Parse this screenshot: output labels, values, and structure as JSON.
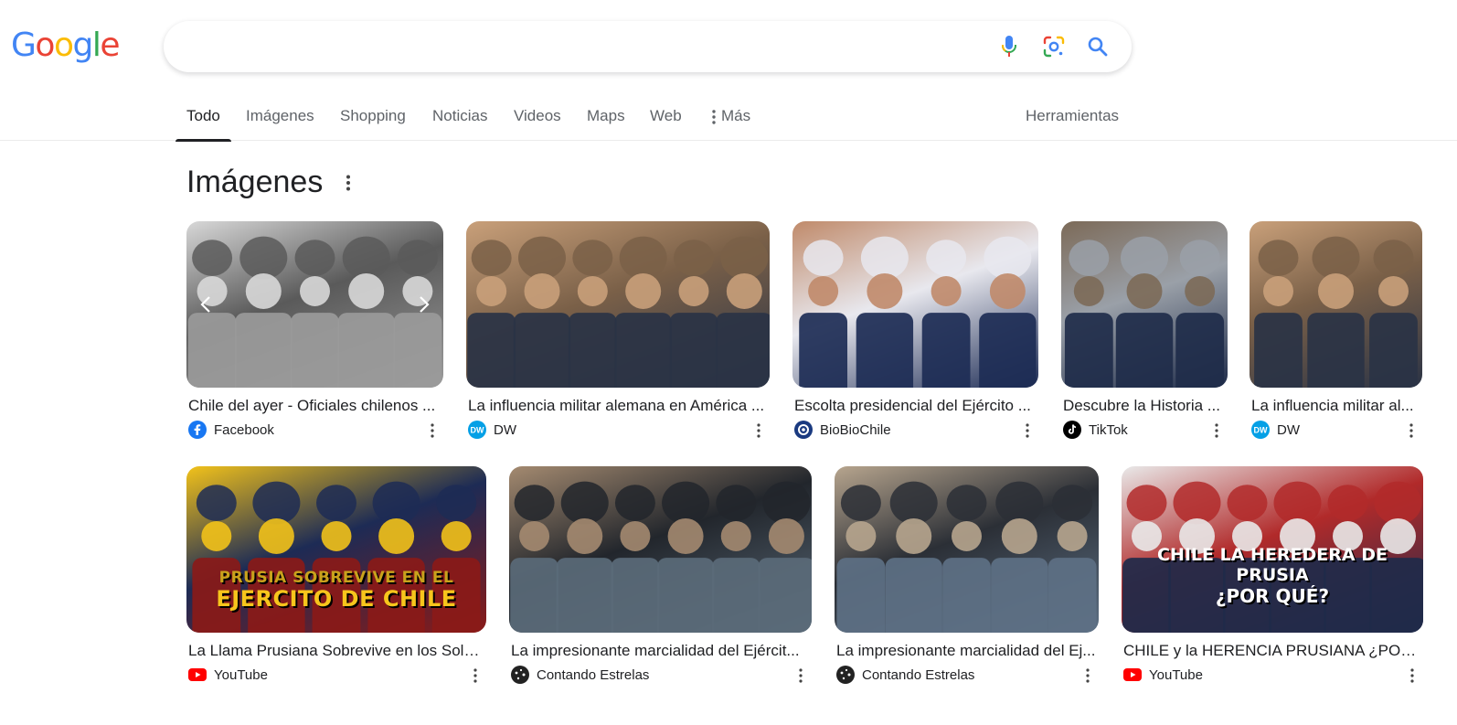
{
  "logo": {
    "text": "Google",
    "letters": [
      "G",
      "o",
      "o",
      "g",
      "l",
      "e"
    ],
    "colors": [
      "#4285F4",
      "#EA4335",
      "#FBBC05",
      "#4285F4",
      "#34A853",
      "#EA4335"
    ]
  },
  "search": {
    "value": "",
    "placeholder": ""
  },
  "tabs": [
    {
      "label": "Todo",
      "active": true
    },
    {
      "label": "Imágenes"
    },
    {
      "label": "Shopping"
    },
    {
      "label": "Noticias"
    },
    {
      "label": "Videos"
    },
    {
      "label": "Maps"
    },
    {
      "label": "Web"
    },
    {
      "label": "Más"
    },
    {
      "label": "Herramientas"
    }
  ],
  "section": {
    "title": "Imágenes"
  },
  "images": [
    {
      "caption": "Chile del ayer - Oficiales chilenos ...",
      "source": "Facebook",
      "source_icon": "facebook-icon",
      "source_color": "#1877F2",
      "palette": [
        "#9a9a9a",
        "#5a5a5a",
        "#d8d8d8"
      ]
    },
    {
      "caption": "La influencia militar alemana en América ...",
      "source": "DW",
      "source_icon": "dw-icon",
      "source_color": "#05a0e6",
      "palette": [
        "#2a3345",
        "#7a6048",
        "#c9a07a"
      ]
    },
    {
      "caption": "Escolta presidencial del Ejército ...",
      "source": "BioBioChile",
      "source_icon": "biobiochile-icon",
      "source_color": "#1a3a80",
      "palette": [
        "#1d2c55",
        "#e8e8ee",
        "#c08a6a"
      ]
    },
    {
      "caption": "Descubre la Historia ...",
      "source": "TikTok",
      "source_icon": "tiktok-icon",
      "source_color": "#000000",
      "palette": [
        "#1f2c4a",
        "#9aa0a8",
        "#7c6a58"
      ]
    },
    {
      "caption": "La influencia militar al...",
      "source": "DW",
      "source_icon": "dw-icon",
      "source_color": "#05a0e6",
      "palette": [
        "#2a3345",
        "#7a6048",
        "#c9a07a"
      ]
    },
    {
      "caption": "La Llama Prusiana Sobrevive en los Sold...",
      "source": "YouTube",
      "source_icon": "youtube-icon",
      "source_color": "#FF0000",
      "palette": [
        "#8a1a18",
        "#1d2b55",
        "#f2c21a"
      ],
      "overlay_text": [
        "PRUSIA SOBREVIVE EN EL",
        "EJERCITO DE CHILE"
      ]
    },
    {
      "caption": "La impresionante marcialidad del Ejércit...",
      "source": "Contando Estrelas",
      "source_icon": "contando-estrelas-icon",
      "source_color": "#222222",
      "palette": [
        "#5a6a78",
        "#22262c",
        "#a48a70"
      ]
    },
    {
      "caption": "La impresionante marcialidad del Ej...",
      "source": "Contando Estrelas",
      "source_icon": "contando-estrelas-icon",
      "source_color": "#222222",
      "palette": [
        "#5d7084",
        "#2b2f36",
        "#b7a58e"
      ]
    },
    {
      "caption": "CHILE y la HERENCIA PRUSIANA ¿POR Q...",
      "source": "YouTube",
      "source_icon": "youtube-icon",
      "source_color": "#FF0000",
      "palette": [
        "#1f2a4a",
        "#b12a2a",
        "#e9e9e9"
      ],
      "overlay_text": [
        "CHILE LA HEREDERA DE PRUSIA",
        "¿POR QUÉ?"
      ]
    }
  ]
}
